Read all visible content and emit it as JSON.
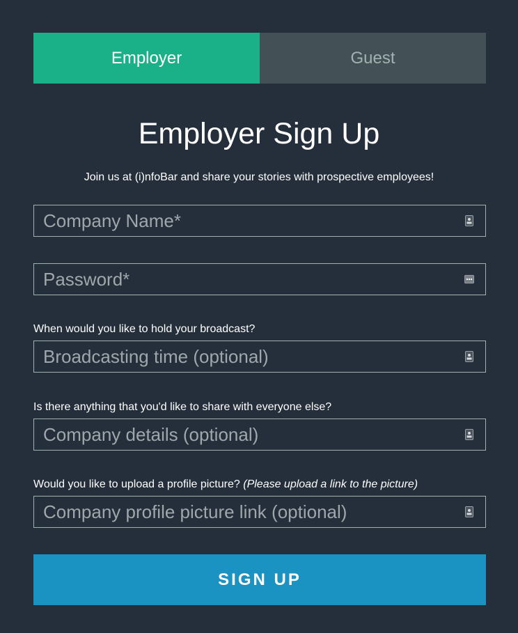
{
  "tabs": [
    {
      "label": "Employer",
      "active": true
    },
    {
      "label": "Guest",
      "active": false
    }
  ],
  "title": "Employer Sign Up",
  "subtitle": "Join us at (i)nfoBar and share your stories with prospective employees!",
  "fields": {
    "company_name": {
      "placeholder": "Company Name*",
      "value": "",
      "icon": "contact-card-icon"
    },
    "password": {
      "placeholder": "Password*",
      "value": "",
      "icon": "password-dots-icon"
    },
    "broadcast_time": {
      "question": "When would you like to hold your broadcast?",
      "placeholder": "Broadcasting time (optional)",
      "value": "",
      "icon": "contact-card-icon"
    },
    "company_details": {
      "question": "Is there anything that you'd like to share with everyone else?",
      "placeholder": "Company details (optional)",
      "value": "",
      "icon": "contact-card-icon"
    },
    "profile_picture": {
      "question": "Would you like to upload a profile picture?",
      "question_note": "(Please upload a link to the picture)",
      "placeholder": "Company profile picture link (optional)",
      "value": "",
      "icon": "contact-card-icon"
    }
  },
  "signup_label": "SIGN UP",
  "colors": {
    "background": "#242f3b",
    "tab_active": "#1ab188",
    "tab_inactive": "#435157",
    "signup_button": "#1a93c3",
    "field_border": "#a0b3b0"
  }
}
